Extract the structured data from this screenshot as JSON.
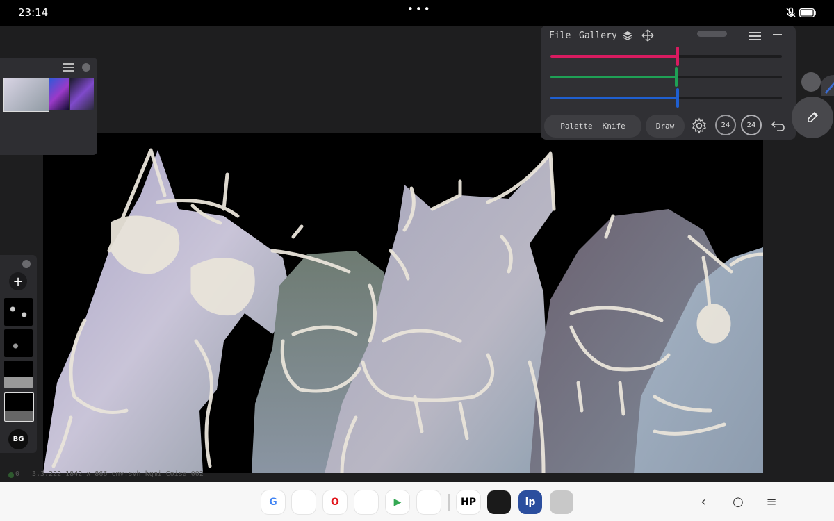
{
  "status_bar": {
    "time": "23:14",
    "dots": "•••",
    "mute_icon": "mic-off-icon",
    "battery_icon": "battery-icon"
  },
  "tool_panel": {
    "menu": [
      "File",
      "Gallery"
    ],
    "sliders": [
      {
        "name": "red",
        "color": "#d81b60",
        "value": 0.55
      },
      {
        "name": "green",
        "color": "#1fa055",
        "value": 0.545
      },
      {
        "name": "blue",
        "color": "#1f5fd0",
        "value": 0.55
      }
    ],
    "buttons": {
      "palette": "Palette",
      "knife": "Knife",
      "draw": "Draw"
    },
    "dials": {
      "size": "24",
      "opacity": "24"
    }
  },
  "layers": {
    "bg_label": "BG"
  },
  "info_bar": {
    "text": "3.3.222  1842 x 866 cnv:svh kqmi Coisa 002",
    "zero": "0"
  },
  "dock": {
    "apps": [
      {
        "name": "Google",
        "label": "G",
        "color": "#ffffff",
        "fg": "#4285f4"
      },
      {
        "name": "Messages",
        "label": "",
        "color": "#ffffff",
        "fg": "#1a73e8"
      },
      {
        "name": "Opera",
        "label": "O",
        "color": "#ffffff",
        "fg": "#e2161c"
      },
      {
        "name": "Assistant",
        "label": "",
        "color": "#ffffff",
        "fg": "#4285f4"
      },
      {
        "name": "Play Store",
        "label": "▶",
        "color": "#ffffff",
        "fg": "#34a853"
      },
      {
        "name": "Photos",
        "label": "",
        "color": "#ffffff",
        "fg": "#ea4335"
      },
      {
        "name": "HP",
        "label": "HP",
        "color": "#ffffff",
        "fg": "#000000"
      },
      {
        "name": "Sketch",
        "label": "",
        "color": "#1a1a1a",
        "fg": "#ffffff"
      },
      {
        "name": "ibisPaint",
        "label": "ip",
        "color": "#2b4e9e",
        "fg": "#ffffff"
      },
      {
        "name": "App drawer",
        "label": "",
        "color": "#c8c8c8",
        "fg": "#777"
      }
    ],
    "nav": {
      "back": "‹",
      "home": "○",
      "menu": "≡"
    }
  }
}
